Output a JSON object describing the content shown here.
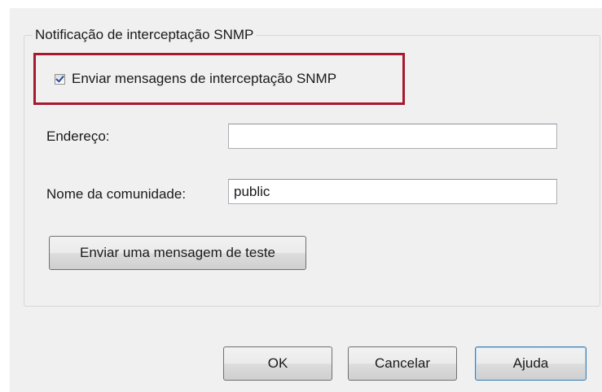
{
  "group": {
    "title": "Notificação de interceptação SNMP"
  },
  "trap": {
    "checkbox_label": "Enviar mensagens de interceptação SNMP",
    "checked": true,
    "highlight_color": "#a6192e"
  },
  "address": {
    "label": "Endereço:",
    "value": ""
  },
  "community": {
    "label": "Nome da comunidade:",
    "value": "public"
  },
  "test_button": {
    "label": "Enviar uma mensagem de teste"
  },
  "footer": {
    "ok_label": "OK",
    "cancel_label": "Cancelar",
    "help_label": "Ajuda"
  }
}
